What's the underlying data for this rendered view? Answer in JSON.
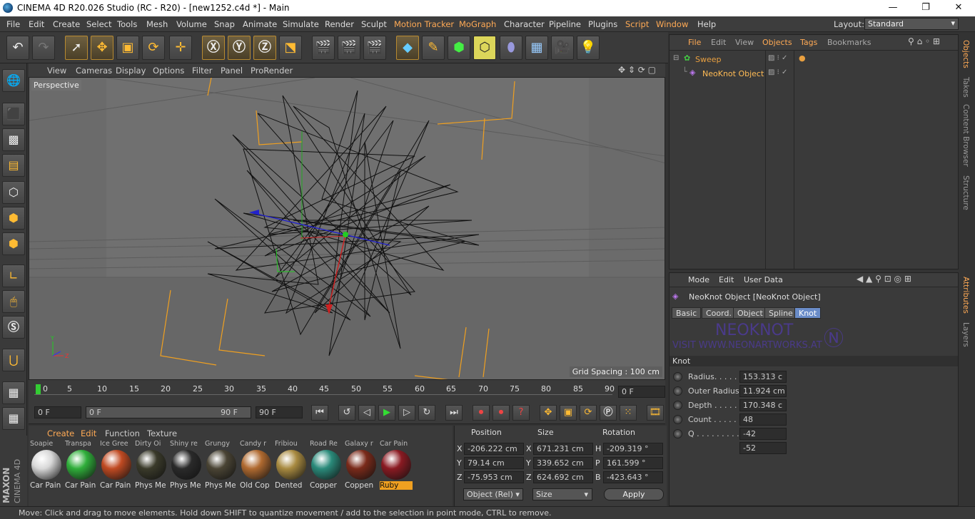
{
  "window": {
    "title": "CINEMA 4D R20.026 Studio (RC - R20) - [new1252.c4d *] - Main",
    "minimize": "—",
    "maximize": "❐",
    "close": "✕"
  },
  "menu": {
    "items": [
      "File",
      "Edit",
      "Create",
      "Select",
      "Tools",
      "Mesh",
      "Volume",
      "Snap",
      "Animate",
      "Simulate",
      "Render",
      "Sculpt",
      "Motion Tracker",
      "MoGraph",
      "Character",
      "Pipeline",
      "Plugins",
      "Script",
      "Window",
      "Help"
    ],
    "layout_label": "Layout:",
    "layout_value": "Standard"
  },
  "viewport": {
    "menu": [
      "View",
      "Cameras",
      "Display",
      "Options",
      "Filter",
      "Panel",
      "ProRender"
    ],
    "label": "Perspective",
    "grid_spacing": "Grid Spacing : 100 cm"
  },
  "timeline": {
    "ticks": [
      "0",
      "5",
      "10",
      "15",
      "20",
      "25",
      "30",
      "35",
      "40",
      "45",
      "50",
      "55",
      "60",
      "65",
      "70",
      "75",
      "80",
      "85",
      "90"
    ],
    "current_frame": "0 F"
  },
  "transport": {
    "start": "0 F",
    "range_start": "0 F",
    "range_end": "90 F",
    "end": "90 F"
  },
  "materials": {
    "menu": [
      "Create",
      "Edit",
      "Function",
      "Texture"
    ],
    "items": [
      {
        "top": "Soapie",
        "name": "Car Pain",
        "color": "#d8d8d8"
      },
      {
        "top": "Transpa",
        "name": "Car Pain",
        "color": "#2fae3a"
      },
      {
        "top": "Ice Gree",
        "name": "Car Pain",
        "color": "#c04a22"
      },
      {
        "top": "Dirty Oi",
        "name": "Phys Me",
        "color": "#3a3a2a"
      },
      {
        "top": "Shiny re",
        "name": "Phys Me",
        "color": "#2a2a2a"
      },
      {
        "top": "Grungy",
        "name": "Phys Me",
        "color": "#4a4434"
      },
      {
        "top": "Candy r",
        "name": "Old Cop",
        "color": "#b06a30"
      },
      {
        "top": "Fribiou",
        "name": "Dented",
        "color": "#a88a40"
      },
      {
        "top": "Road Re",
        "name": "Copper",
        "color": "#2a8a7a"
      },
      {
        "top": "Galaxy r",
        "name": "Coppen",
        "color": "#7a2a1a"
      },
      {
        "top": "Car Pain",
        "name": "Ruby",
        "color": "#8a1a22"
      }
    ]
  },
  "coords": {
    "headers": [
      "Position",
      "Size",
      "Rotation"
    ],
    "rows": [
      {
        "axis": "X",
        "pos": "-206.222 cm",
        "saxis": "X",
        "size": "671.231 cm",
        "raxis": "H",
        "rot": "-209.319 °"
      },
      {
        "axis": "Y",
        "pos": "79.14 cm",
        "saxis": "Y",
        "size": "339.652 cm",
        "raxis": "P",
        "rot": "161.599 °"
      },
      {
        "axis": "Z",
        "pos": "-75.953 cm",
        "saxis": "Z",
        "size": "624.692 cm",
        "raxis": "B",
        "rot": "-423.643 °"
      }
    ],
    "mode": "Object (Rel)",
    "size_mode": "Size",
    "apply": "Apply"
  },
  "objects": {
    "menu": [
      "File",
      "Edit",
      "View",
      "Objects",
      "Tags",
      "Bookmarks"
    ],
    "tree": [
      "Sweep",
      "NeoKnot Object"
    ]
  },
  "attributes": {
    "menu": [
      "Mode",
      "Edit",
      "User Data"
    ],
    "title": "NeoKnot Object [NeoKnot Object]",
    "tabs": [
      "Basic",
      "Coord.",
      "Object",
      "Spline",
      "Knot"
    ],
    "banner_title": "NEOKNOT",
    "banner_url": "VISIT WWW.NEONARTWORKS.AT",
    "section": "Knot",
    "fields": [
      {
        "label": "Radius. . . . . .",
        "value": "153.313 c"
      },
      {
        "label": "Outer Radius",
        "value": "11.924 cm"
      },
      {
        "label": "Depth . . . . . .",
        "value": "170.348 c"
      },
      {
        "label": "Count . . . . . .",
        "value": "48"
      },
      {
        "label": "Q . . . . . . . . . .",
        "value": "-42"
      },
      {
        "label": "",
        "value": "-52"
      }
    ]
  },
  "right_tabs": [
    "Objects",
    "Takes",
    "Content Browser",
    "Structure",
    "Attributes",
    "Layers"
  ],
  "status": "Move: Click and drag to move elements. Hold down SHIFT to quantize movement / add to the selection in point mode, CTRL to remove.",
  "brand": {
    "maxon": "MAXON",
    "cinema": "CINEMA 4D"
  }
}
